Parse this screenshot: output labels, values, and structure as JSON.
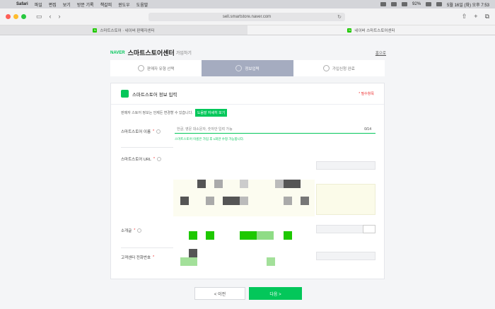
{
  "menubar": {
    "items": [
      "Safari",
      "파일",
      "편집",
      "보기",
      "방문 기록",
      "책갈피",
      "윈도우",
      "도움말"
    ],
    "battery": "92%",
    "clock": "5월 16일 (화) 오후 7:53"
  },
  "browser": {
    "url": "sell.smartstore.naver.com",
    "tabs": [
      {
        "label": "스마트스토어 · 네이버 판매자센터",
        "active": false
      },
      {
        "label": "네이버 스마트스토어센터",
        "active": true
      }
    ]
  },
  "header": {
    "naver": "NAVER",
    "title": "스마트스토어센터",
    "subtitle": "가입하기",
    "home_link": "홈으로"
  },
  "steps": [
    {
      "label": "판매자 유형 선택",
      "active": false
    },
    {
      "label": "정보입력",
      "active": true
    },
    {
      "label": "가입신청 완료",
      "active": false
    }
  ],
  "card": {
    "title": "스마트스토어 정보 입력",
    "required_note": "* 필수항목",
    "notice_text": "판매자 스토어 정보는 언제든 변경할 수 있습니다.",
    "notice_button": "도움말 자세히 보기",
    "rows": [
      {
        "label": "스마트스토어 이름",
        "placeholder": "한글, 영문 대소문자, 숫자만 입력 가능",
        "suffix": "0/14"
      },
      {
        "label": "스마트스토어 URL"
      },
      {
        "label": "소개글"
      },
      {
        "label": "고객센터 전화번호"
      }
    ],
    "helper_text": "스마트스토어 이름은 가입 후 1회만 수정 가능합니다."
  },
  "buttons": {
    "prev": "< 이전",
    "next": "다음 >"
  },
  "colors": {
    "accent": "#03c75a",
    "step_active": "#a5acc0"
  }
}
